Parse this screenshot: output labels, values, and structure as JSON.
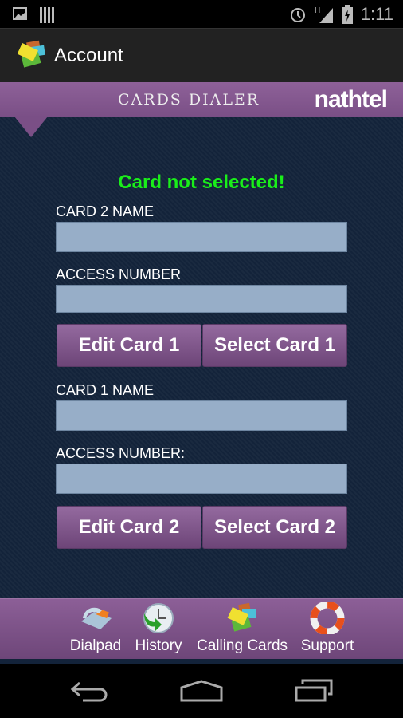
{
  "status_bar": {
    "time": "1:11",
    "network": "H",
    "icons": [
      "image-icon",
      "sim-icon",
      "alarm-icon",
      "signal-icon",
      "battery-charging-icon"
    ]
  },
  "action_bar": {
    "title": "Account"
  },
  "banner": {
    "title": "CARDS DIALER",
    "logo": "nathtel"
  },
  "main": {
    "message": "Card not selected!",
    "message_color": "#1aee1a",
    "card_a": {
      "name_label": "CARD 2 NAME",
      "name_value": "",
      "access_label": "ACCESS NUMBER",
      "access_value": "",
      "edit_label": "Edit Card 1",
      "select_label": "Select Card 1"
    },
    "card_b": {
      "name_label": "CARD 1 NAME",
      "name_value": "",
      "access_label": "ACCESS NUMBER:",
      "access_value": "",
      "edit_label": "Edit Card 2",
      "select_label": "Select Card 2"
    }
  },
  "bottom_nav": {
    "items": [
      {
        "label": "Dialpad",
        "icon": "phone-icon"
      },
      {
        "label": "History",
        "icon": "clock-icon"
      },
      {
        "label": "Calling Cards",
        "icon": "cards-icon"
      },
      {
        "label": "Support",
        "icon": "lifebuoy-icon"
      }
    ]
  },
  "accent_color": "#7a4f86"
}
